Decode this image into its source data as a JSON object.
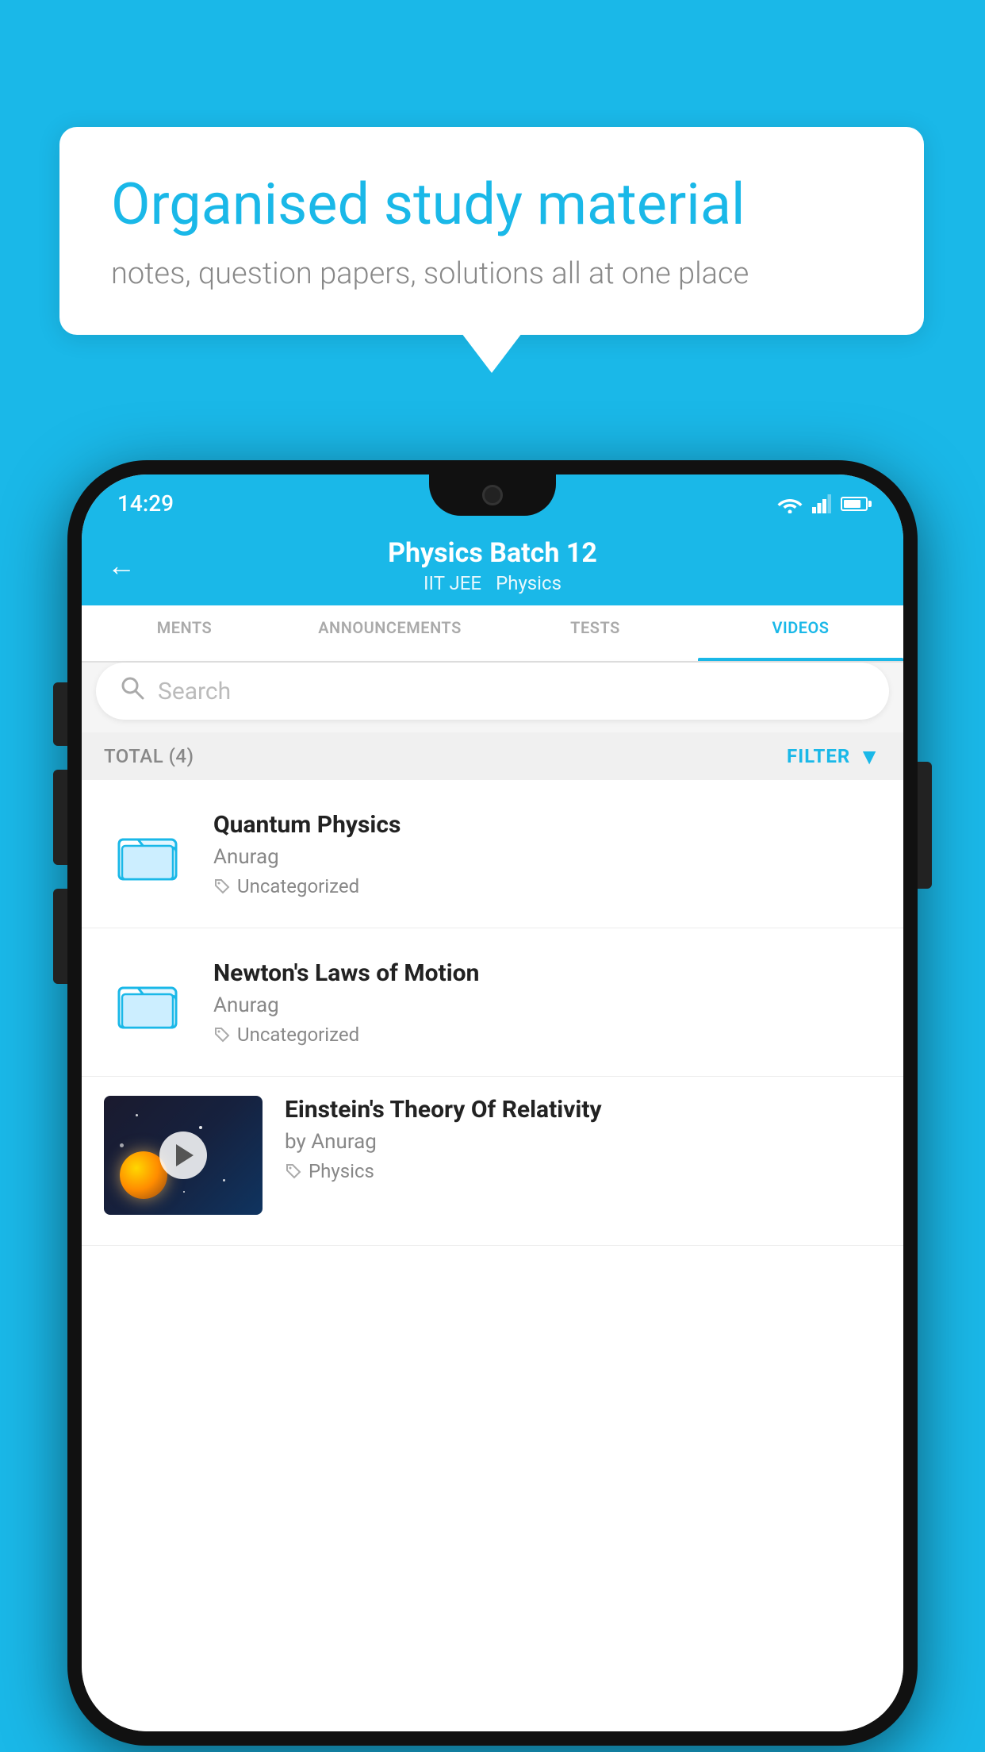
{
  "background_color": "#1ab8e8",
  "speech_bubble": {
    "title": "Organised study material",
    "subtitle": "notes, question papers, solutions all at one place"
  },
  "phone": {
    "status_bar": {
      "time": "14:29",
      "wifi": true,
      "signal": true,
      "battery": true
    },
    "header": {
      "back_label": "←",
      "title": "Physics Batch 12",
      "subtitle_1": "IIT JEE",
      "subtitle_2": "Physics"
    },
    "tabs": [
      {
        "label": "MENTS",
        "active": false
      },
      {
        "label": "ANNOUNCEMENTS",
        "active": false
      },
      {
        "label": "TESTS",
        "active": false
      },
      {
        "label": "VIDEOS",
        "active": true
      }
    ],
    "search": {
      "placeholder": "Search"
    },
    "filter_bar": {
      "total": "TOTAL (4)",
      "filter_label": "FILTER"
    },
    "videos": [
      {
        "title": "Quantum Physics",
        "author": "Anurag",
        "tag": "Uncategorized",
        "type": "folder",
        "has_thumbnail": false
      },
      {
        "title": "Newton's Laws of Motion",
        "author": "Anurag",
        "tag": "Uncategorized",
        "type": "folder",
        "has_thumbnail": false
      },
      {
        "title": "Einstein's Theory Of Relativity",
        "author": "by Anurag",
        "tag": "Physics",
        "type": "video",
        "has_thumbnail": true
      }
    ]
  }
}
